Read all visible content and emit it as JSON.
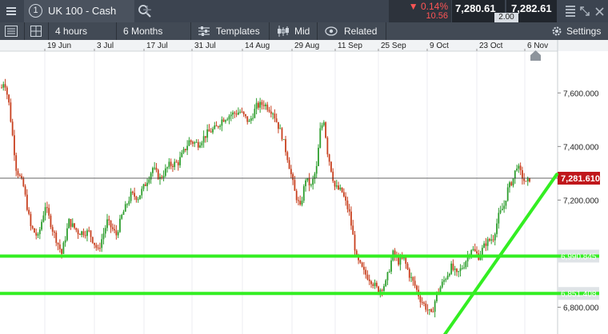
{
  "topbar": {
    "instrument_number": "1",
    "instrument_name": "UK 100 - Cash",
    "change_pct": "▼ 0.14%",
    "change_abs": "10.56",
    "sell_price": "7,280.61",
    "buy_price": "7,282.61",
    "spread": "2.00"
  },
  "toolbar": {
    "interval": "4 hours",
    "period": "6 Months",
    "templates": "Templates",
    "price_type": "Mid",
    "related": "Related",
    "settings": "Settings"
  },
  "chart_data": {
    "type": "candlestick",
    "x_labels": [
      "19 Jun",
      "3 Jul",
      "17 Jul",
      "31 Jul",
      "14 Aug",
      "29 Aug",
      "11 Sep",
      "25 Sep",
      "9 Oct",
      "23 Oct",
      "6 Nov"
    ],
    "y_ticks": [
      "7,600.000",
      "7,400.000",
      "7,200.000",
      "6,800.000"
    ],
    "ylim": [
      6700,
      7750
    ],
    "current_price_label": "7,281.610",
    "current_price": 7281.61,
    "support_levels": [
      {
        "label": "6,990.845",
        "value": 6990.845
      },
      {
        "label": "6,851.408",
        "value": 6851.408
      }
    ],
    "trendline": {
      "from_date": "9 Oct",
      "from_price": 6690,
      "to_date": "10 Nov",
      "to_price": 7296
    },
    "price_path": [
      [
        0,
        7620
      ],
      [
        1.5,
        7650
      ],
      [
        4,
        7560
      ],
      [
        8,
        7320
      ],
      [
        12,
        7250
      ],
      [
        16,
        7100
      ],
      [
        20,
        7060
      ],
      [
        24,
        7180
      ],
      [
        28,
        7090
      ],
      [
        33,
        7000
      ],
      [
        37,
        7120
      ],
      [
        42,
        7080
      ],
      [
        48,
        7080
      ],
      [
        53,
        7010
      ],
      [
        58,
        7120
      ],
      [
        63,
        7070
      ],
      [
        66,
        7140
      ],
      [
        71,
        7220
      ],
      [
        75,
        7210
      ],
      [
        79,
        7260
      ],
      [
        83,
        7320
      ],
      [
        87,
        7280
      ],
      [
        92,
        7330
      ],
      [
        97,
        7340
      ],
      [
        103,
        7420
      ],
      [
        108,
        7410
      ],
      [
        113,
        7450
      ],
      [
        118,
        7470
      ],
      [
        121,
        7500
      ],
      [
        126,
        7520
      ],
      [
        131,
        7530
      ],
      [
        136,
        7490
      ],
      [
        140,
        7550
      ],
      [
        144,
        7560
      ],
      [
        149,
        7530
      ],
      [
        154,
        7440
      ],
      [
        157,
        7360
      ],
      [
        161,
        7230
      ],
      [
        164,
        7170
      ],
      [
        167,
        7280
      ],
      [
        170,
        7250
      ],
      [
        173,
        7320
      ],
      [
        175,
        7460
      ],
      [
        177,
        7500
      ],
      [
        179,
        7380
      ],
      [
        183,
        7250
      ],
      [
        187,
        7230
      ],
      [
        191,
        7150
      ],
      [
        195,
        6980
      ],
      [
        199,
        6930
      ],
      [
        203,
        6900
      ],
      [
        207,
        6860
      ],
      [
        211,
        6890
      ],
      [
        215,
        7000
      ],
      [
        218,
        6970
      ],
      [
        221,
        6980
      ],
      [
        224,
        6920
      ],
      [
        227,
        6880
      ],
      [
        230,
        6830
      ],
      [
        234,
        6790
      ],
      [
        236,
        6770
      ],
      [
        239,
        6850
      ],
      [
        243,
        6900
      ],
      [
        247,
        6950
      ],
      [
        250,
        6920
      ],
      [
        254,
        6960
      ],
      [
        258,
        7020
      ],
      [
        262,
        6990
      ],
      [
        266,
        7040
      ],
      [
        270,
        7060
      ],
      [
        273,
        7140
      ],
      [
        276,
        7180
      ],
      [
        278,
        7240
      ],
      [
        281,
        7280
      ],
      [
        283,
        7330
      ],
      [
        285,
        7300
      ],
      [
        288,
        7260
      ],
      [
        290,
        7280
      ]
    ]
  }
}
